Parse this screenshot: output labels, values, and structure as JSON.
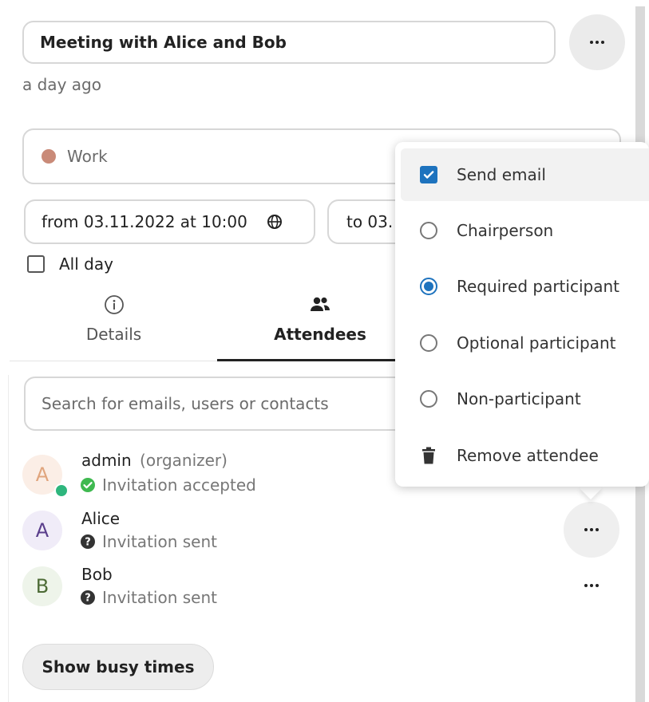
{
  "event": {
    "title": "Meeting with Alice and Bob",
    "modified": "a day ago"
  },
  "calendar": {
    "name": "Work",
    "color": "#c98a78"
  },
  "dates": {
    "from": "from 03.11.2022 at 10:00",
    "to": "to 03."
  },
  "all_day": {
    "label": "All day",
    "checked": false
  },
  "tabs": [
    {
      "label": "Details",
      "icon": "info-icon",
      "active": false
    },
    {
      "label": "Attendees",
      "icon": "people-icon",
      "active": true
    }
  ],
  "search": {
    "placeholder": "Search for emails, users or contacts"
  },
  "attendees": [
    {
      "initial": "A",
      "name": "admin",
      "role": "(organizer)",
      "status": "Invitation accepted",
      "status_icon": "check-circle-icon",
      "online": true
    },
    {
      "initial": "A",
      "name": "Alice",
      "role": "",
      "status": "Invitation sent",
      "status_icon": "question-circle-icon"
    },
    {
      "initial": "B",
      "name": "Bob",
      "role": "",
      "status": "Invitation sent",
      "status_icon": "question-circle-icon"
    }
  ],
  "busy_button": "Show busy times",
  "menu": {
    "items": [
      {
        "label": "Send email",
        "control": "checkbox",
        "checked": true
      },
      {
        "label": "Chairperson",
        "control": "radio",
        "checked": false
      },
      {
        "label": "Required participant",
        "control": "radio",
        "checked": true
      },
      {
        "label": "Optional participant",
        "control": "radio",
        "checked": false
      },
      {
        "label": "Non-participant",
        "control": "radio",
        "checked": false
      },
      {
        "label": "Remove attendee",
        "control": "trash-icon",
        "checked": false
      }
    ]
  },
  "colors": {
    "accent": "#1e73be",
    "accepted": "#3fb950",
    "online": "#2eb67d"
  }
}
